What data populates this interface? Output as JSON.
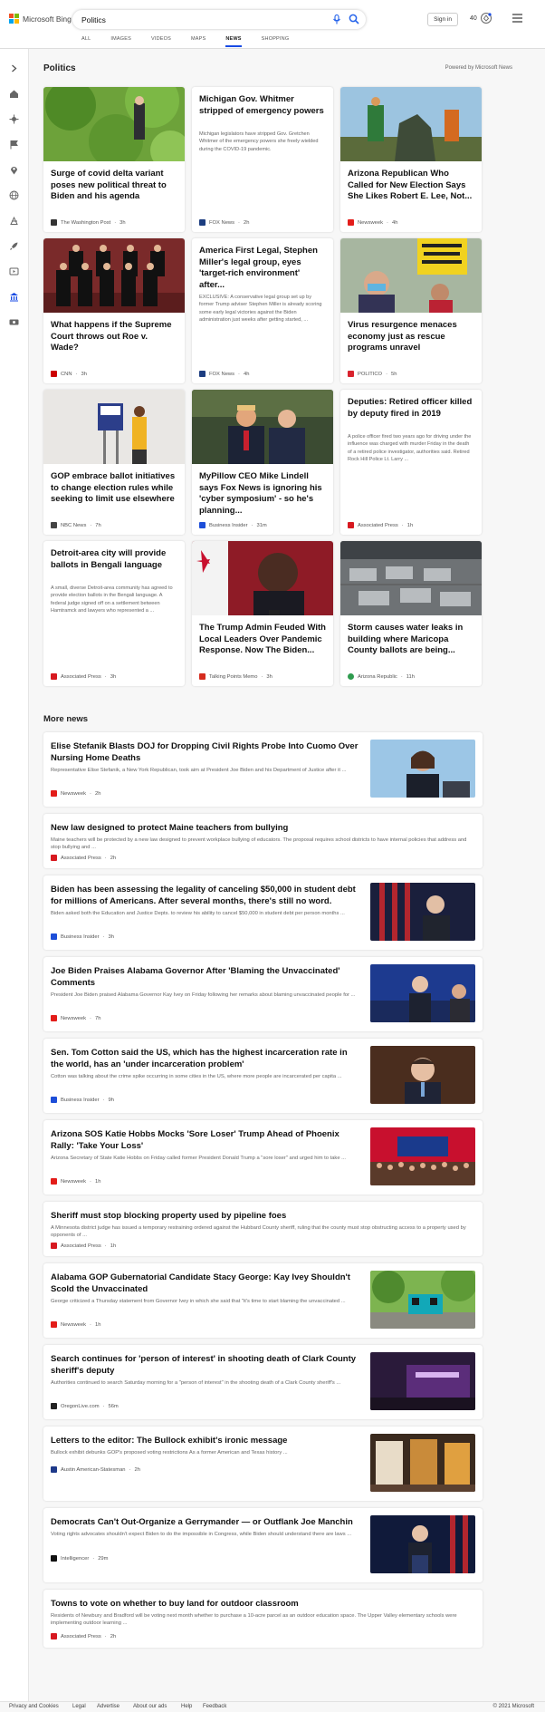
{
  "header": {
    "logo_text": "Microsoft Bing",
    "search_value": "Politics",
    "signin_label": "Sign in",
    "rewards_count": "40",
    "tabs": [
      {
        "label": "ALL"
      },
      {
        "label": "IMAGES"
      },
      {
        "label": "VIDEOS"
      },
      {
        "label": "MAPS"
      },
      {
        "label": "NEWS"
      },
      {
        "label": "SHOPPING"
      }
    ],
    "active_tab": "NEWS"
  },
  "section": {
    "title": "Politics",
    "powered_by": "Powered by Microsoft News"
  },
  "cards": [
    {
      "title": "Surge of covid delta variant poses new political threat to Biden and his agenda",
      "snippet": "",
      "source": "The Washington Post",
      "time": "3h"
    },
    {
      "title": "Michigan Gov. Whitmer stripped of emergency powers",
      "snippet": "Michigan legislators have stripped Gov. Gretchen Whitmer of the emergency powers she freely wielded during the COVID-19 pandemic.",
      "source": "FOX News",
      "time": "2h"
    },
    {
      "title": "Arizona Republican Who Called for New Election Says She Likes Robert E. Lee, Not...",
      "snippet": "",
      "source": "Newsweek",
      "time": "4h"
    },
    {
      "title": "What happens if the Supreme Court throws out Roe v. Wade?",
      "snippet": "",
      "source": "CNN",
      "time": "3h"
    },
    {
      "title": "America First Legal, Stephen Miller's legal group, eyes 'target-rich environment' after...",
      "snippet": "EXCLUSIVE: A conservative legal group set up by former Trump adviser Stephen Miller is already scoring some early legal victories against the Biden administration just weeks after getting started, ...",
      "source": "FOX News",
      "time": "4h"
    },
    {
      "title": "Virus resurgence menaces economy just as rescue programs unravel",
      "snippet": "",
      "source": "POLITICO",
      "time": "5h"
    },
    {
      "title": "GOP embrace ballot initiatives to change election rules while seeking to limit use elsewhere",
      "snippet": "",
      "source": "NBC News",
      "time": "7h"
    },
    {
      "title": "MyPillow CEO Mike Lindell says Fox News is ignoring his 'cyber symposium' - so he's planning...",
      "snippet": "",
      "source": "Business Insider",
      "time": "31m"
    },
    {
      "title": "Deputies: Retired officer killed by deputy fired in 2019",
      "snippet": "A police officer fired two years ago for driving under the influence was charged with murder Friday in the death of a retired police investigator, authorities said. Retired Rock Hill Police Lt. Larry ...",
      "source": "Associated Press",
      "time": "1h"
    },
    {
      "title": "Detroit-area city will provide ballots in Bengali language",
      "snippet": "A small, diverse Detroit-area community has agreed to provide election ballots in the Bengali language. A federal judge signed off on a settlement between Hamtramck and lawyers who represented a ...",
      "source": "Associated Press",
      "time": "3h"
    },
    {
      "title": "The Trump Admin Feuded With Local Leaders Over Pandemic Response. Now The Biden...",
      "snippet": "",
      "source": "Talking Points Memo",
      "time": "3h"
    },
    {
      "title": "Storm causes water leaks in building where Maricopa County ballots are being...",
      "snippet": "",
      "source": "Arizona Republic",
      "time": "11h"
    }
  ],
  "more_news_title": "More news",
  "news": [
    {
      "title": "Elise Stefanik Blasts DOJ for Dropping Civil Rights Probe Into Cuomo Over Nursing Home Deaths",
      "snippet": "Representative Elise Stefanik, a New York Republican, took aim at President Joe Biden and his Department of Justice after it ...",
      "source": "Newsweek",
      "time": "2h"
    },
    {
      "title": "New law designed to protect Maine teachers from bullying",
      "snippet": "Maine teachers will be protected by a new law designed to prevent workplace bullying of educators. The proposal requires school districts to have internal policies that address and stop bullying and ...",
      "source": "Associated Press",
      "time": "2h"
    },
    {
      "title": "Biden has been assessing the legality of canceling $50,000 in student debt for millions of Americans. After several months, there's still no word.",
      "snippet": "Biden asked both the Education and Justice Depts. to review his ability to cancel $50,000 in student debt per person months ...",
      "source": "Business Insider",
      "time": "3h"
    },
    {
      "title": "Joe Biden Praises Alabama Governor After 'Blaming the Unvaccinated' Comments",
      "snippet": "President Joe Biden praised Alabama Governor Kay Ivey on Friday following her remarks about blaming unvaccinated people for ...",
      "source": "Newsweek",
      "time": "7h"
    },
    {
      "title": "Sen. Tom Cotton said the US, which has the highest incarceration rate in the world, has an 'under incarceration problem'",
      "snippet": "Cotton was talking about the crime spike occurring in some cities in the US, where more people are incarcerated per capita ...",
      "source": "Business Insider",
      "time": "9h"
    },
    {
      "title": "Arizona SOS Katie Hobbs Mocks 'Sore Loser' Trump Ahead of Phoenix Rally: 'Take Your Loss'",
      "snippet": "Arizona Secretary of State Katie Hobbs on Friday called former President Donald Trump a \"sore loser\" and urged him to take ...",
      "source": "Newsweek",
      "time": "1h"
    },
    {
      "title": "Sheriff must stop blocking property used by pipeline foes",
      "snippet": "A Minnesota district judge has issued a temporary restraining ordered against the Hubbard County sheriff, ruling that the county must stop obstructing access to a property used by opponents of ...",
      "source": "Associated Press",
      "time": "1h"
    },
    {
      "title": "Alabama GOP Gubernatorial Candidate Stacy George: Kay Ivey Shouldn't Scold the Unvaccinated",
      "snippet": "George criticized a Thursday statement from Governor Ivey in which she said that \"it's time to start blaming the unvaccinated ...",
      "source": "Newsweek",
      "time": "1h"
    },
    {
      "title": "Search continues for 'person of interest' in shooting death of Clark County sheriff's deputy",
      "snippet": "Authorities continued to search Saturday morning for a \"person of interest\" in the shooting death of a Clark County sheriff's ...",
      "source": "OregonLive.com",
      "time": "56m"
    },
    {
      "title": "Letters to the editor: The Bullock exhibit's ironic message",
      "snippet": "Bullock exhibit debunks GOP's proposed voting restrictions  As a former American and Texas history ...",
      "source": "Austin American-Statesman",
      "time": "2h"
    },
    {
      "title": "Democrats Can't Out-Organize a Gerrymander — or Outflank Joe Manchin",
      "snippet": "Voting rights advocates shouldn't expect Biden to do the impossible in Congress, while Biden should understand there are laws ...",
      "source": "Intelligencer",
      "time": "29m"
    },
    {
      "title": "Towns to vote on whether to buy land for outdoor classroom",
      "snippet": "Residents of Newbury and Bradford will be voting next month whether to purchase a 10-acre parcel as an outdoor education space. The Upper Valley elementary schools were implementing outdoor learning ...",
      "source": "Associated Press",
      "time": "2h"
    }
  ],
  "footer": {
    "links": [
      "Privacy and Cookies",
      "Legal",
      "Advertise",
      "About our ads",
      "Help",
      "Feedback"
    ],
    "copyright": "© 2021 Microsoft"
  },
  "colors": {
    "accent": "#174ae4",
    "mic": "#2563eb"
  }
}
